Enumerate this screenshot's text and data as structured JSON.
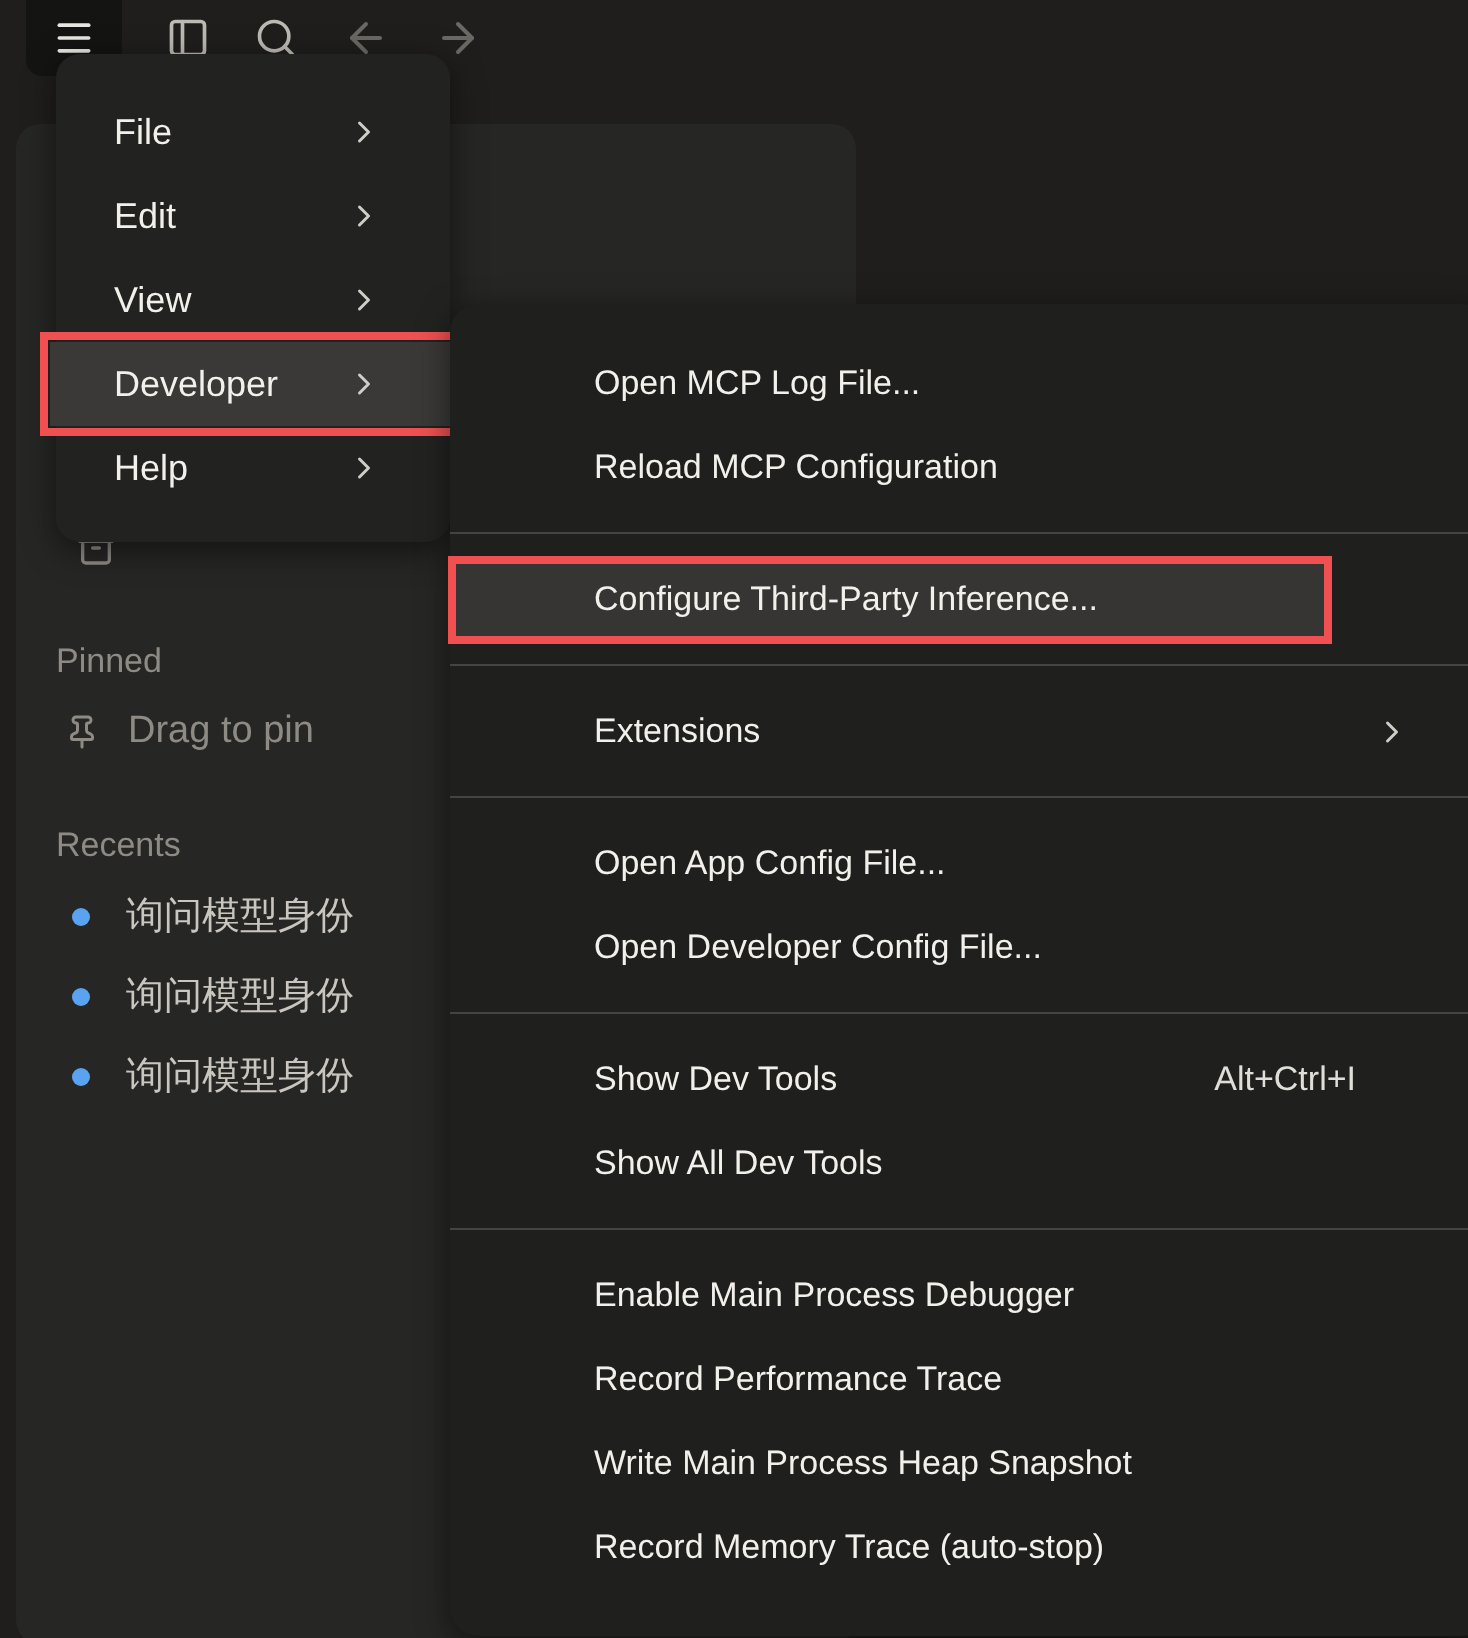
{
  "sidebar": {
    "pinned_heading": "Pinned",
    "pinned_hint": "Drag to pin",
    "recents_heading": "Recents",
    "recents": [
      {
        "title": "询问模型身份"
      },
      {
        "title": "询问模型身份"
      },
      {
        "title": "询问模型身份"
      }
    ]
  },
  "menu": {
    "items": [
      {
        "label": "File",
        "selected": false
      },
      {
        "label": "Edit",
        "selected": false
      },
      {
        "label": "View",
        "selected": false
      },
      {
        "label": "Developer",
        "selected": true
      },
      {
        "label": "Help",
        "selected": false
      }
    ]
  },
  "submenu": {
    "groups": [
      [
        {
          "label": "Open MCP Log File...",
          "selected": false
        },
        {
          "label": "Reload MCP Configuration",
          "selected": false
        }
      ],
      [
        {
          "label": "Configure Third-Party Inference...",
          "selected": true
        }
      ],
      [
        {
          "label": "Extensions",
          "selected": false,
          "has_submenu": true
        }
      ],
      [
        {
          "label": "Open App Config File...",
          "selected": false
        },
        {
          "label": "Open Developer Config File...",
          "selected": false
        }
      ],
      [
        {
          "label": "Show Dev Tools",
          "selected": false,
          "shortcut": "Alt+Ctrl+I"
        },
        {
          "label": "Show All Dev Tools",
          "selected": false
        }
      ],
      [
        {
          "label": "Enable Main Process Debugger",
          "selected": false
        },
        {
          "label": "Record Performance Trace",
          "selected": false
        },
        {
          "label": "Write Main Process Heap Snapshot",
          "selected": false
        },
        {
          "label": "Record Memory Trace (auto-stop)",
          "selected": false
        }
      ]
    ]
  }
}
